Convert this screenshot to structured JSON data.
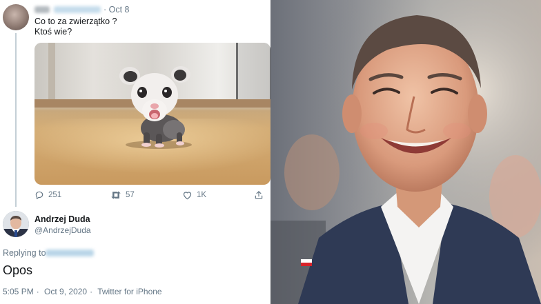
{
  "original_tweet": {
    "time": "Oct 8",
    "text": "Co to za zwierzątko ?\nKtoś wie?",
    "stats": {
      "replies": "251",
      "retweets": "57",
      "likes": "1K"
    }
  },
  "reply": {
    "author_name": "Andrzej Duda",
    "author_handle": "@AndrzejDuda",
    "replying_prefix": "Replying to",
    "text": "Opos",
    "time": "5:05 PM",
    "date": "Oct 9, 2020",
    "source": "Twitter for iPhone",
    "separator": "·"
  },
  "icons": {
    "reply": "reply-icon",
    "retweet": "retweet-icon",
    "like": "heart-icon",
    "share": "share-icon"
  },
  "colors": {
    "secondary_text": "#657786",
    "primary_text": "#14171a",
    "thread_line": "#c4cfd6"
  }
}
